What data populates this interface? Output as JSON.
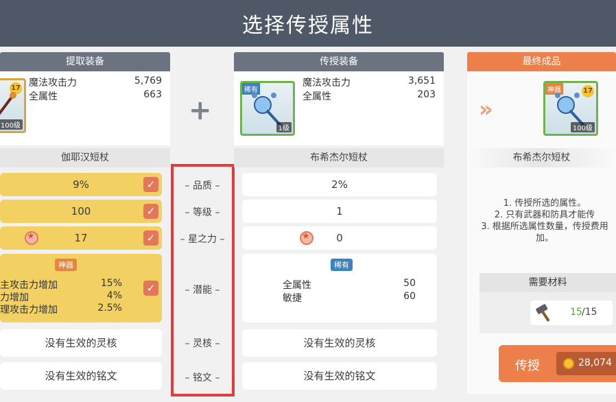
{
  "header": {
    "title": "选择传授属性"
  },
  "left": {
    "head": "提取装备",
    "thumb": {
      "star": "17",
      "level": "100级"
    },
    "stats": [
      {
        "label": "魔法攻击力",
        "value": "5,769"
      },
      {
        "label": "全属性",
        "value": "663"
      }
    ],
    "name": "伽耶汉短杖",
    "rows": {
      "quality": "9%",
      "level": "100",
      "starforce": "17"
    },
    "potential": {
      "tag": "神器",
      "lines": [
        {
          "label": "主攻击力增加",
          "value": "15%"
        },
        {
          "label": "力增加",
          "value": "4%"
        },
        {
          "label": "理攻击力增加",
          "value": "2.5%"
        }
      ]
    },
    "core": "没有生效的灵核",
    "inscription": "没有生效的铭文"
  },
  "middle": {
    "labels": {
      "quality": "– 品质 –",
      "level": "– 等级 –",
      "starforce": "– 星之力 –",
      "potential": "– 潜能 –",
      "core": "– 灵核 –",
      "inscription": "– 铭文 –"
    }
  },
  "center": {
    "head": "传授装备",
    "thumb": {
      "tag": "稀有",
      "level": "1级"
    },
    "stats": [
      {
        "label": "魔法攻击力",
        "value": "3,651"
      },
      {
        "label": "全属性",
        "value": "203"
      }
    ],
    "name": "布希杰尔短杖",
    "rows": {
      "quality": "2%",
      "level": "1",
      "starforce": "0"
    },
    "potential": {
      "tag": "稀有",
      "lines": [
        {
          "label": "全属性",
          "value": "50"
        },
        {
          "label": "敏捷",
          "value": "60"
        }
      ]
    },
    "core": "没有生效的灵核",
    "inscription": "没有生效的铭文"
  },
  "right": {
    "head": "最终成品",
    "thumb": {
      "tag": "神器",
      "star": "17",
      "level": "100级"
    },
    "name": "布希杰尔短杖",
    "notes": [
      "1. 传授所选的属性。",
      "2. 只有武器和防具才能传",
      "3. 根据所选属性数量，传授费用",
      "加。"
    ],
    "materials": {
      "title": "需要材料",
      "have": "15",
      "need": "/15"
    },
    "button": {
      "label": "传授",
      "cost": "28,074"
    }
  }
}
